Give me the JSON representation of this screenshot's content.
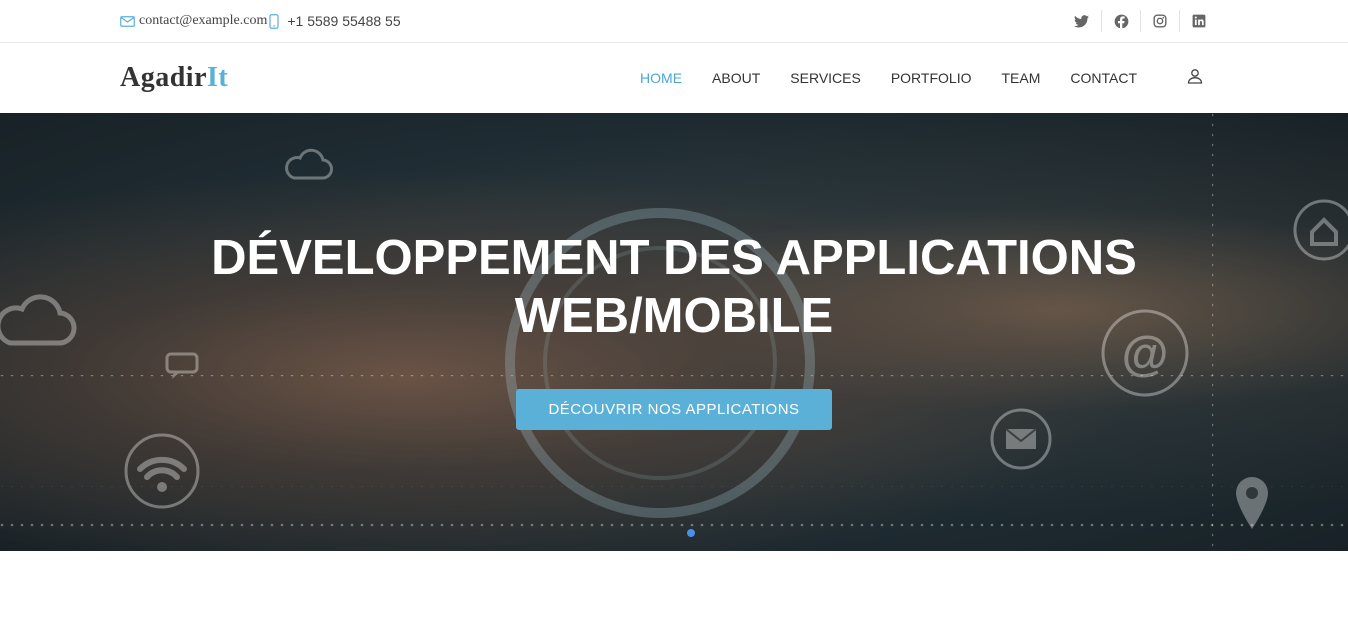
{
  "topbar": {
    "email": "contact@example.com",
    "phone": "+1 5589 55488 55",
    "social": [
      {
        "icon": "twitter-icon"
      },
      {
        "icon": "facebook-icon"
      },
      {
        "icon": "instagram-icon"
      },
      {
        "icon": "linkedin-icon"
      }
    ]
  },
  "header": {
    "logo_main": "Agadir",
    "logo_accent": "It",
    "nav": [
      {
        "label": "HOME",
        "active": true
      },
      {
        "label": "ABOUT"
      },
      {
        "label": "SERVICES"
      },
      {
        "label": "PORTFOLIO"
      },
      {
        "label": "TEAM"
      },
      {
        "label": "CONTACT"
      }
    ],
    "user_icon": "user-icon"
  },
  "hero": {
    "title_line1": "DÉVELOPPEMENT DES APPLICATIONS",
    "title_line2": "WEB/MOBILE",
    "button_label": "DÉCOUVRIR NOS APPLICATIONS",
    "slide_count": 1,
    "active_slide": 1
  },
  "colors": {
    "accent": "#5ab0d6",
    "nav_active": "#4ba6d0",
    "indicator": "#4a8fe8"
  }
}
